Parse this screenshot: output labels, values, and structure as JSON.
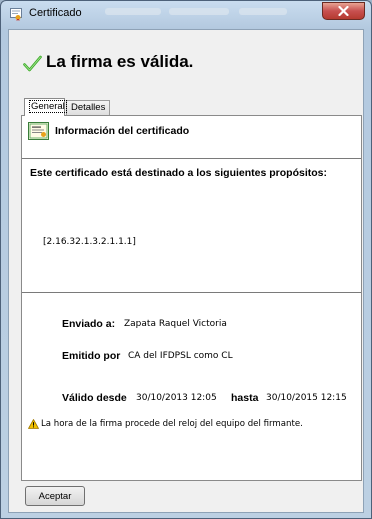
{
  "window": {
    "title": "Certificado"
  },
  "header": {
    "status": "La firma es válida."
  },
  "tabs": [
    {
      "label": "General"
    },
    {
      "label": "Detalles"
    }
  ],
  "panel": {
    "info_title": "Información del certificado",
    "purpose_text": "Este certificado está destinado a los siguientes propósitos:",
    "oid": "[2.16.32.1.3.2.1.1.1]",
    "sent_to_label": "Enviado a:",
    "sent_to_value": "Zapata Raquel Victoria",
    "issued_by_label": "Emitido por",
    "issued_by_value": "CA del IFDPSL como CL",
    "valid_from_label": "Válido desde",
    "valid_from_value": "30/10/2013 12:05",
    "valid_to_label": "hasta",
    "valid_to_value": "30/10/2015 12:15",
    "warning": "La hora de la firma procede del reloj del equipo del firmante."
  },
  "buttons": {
    "accept": "Aceptar"
  },
  "icons": {
    "title": "certificate-icon",
    "check": "check-icon",
    "cert": "certificate-icon",
    "warning": "warning-icon",
    "close": "close-icon"
  },
  "colors": {
    "check_green": "#3fae2a",
    "close_red": "#c75050",
    "warning_yellow": "#f2c200"
  }
}
